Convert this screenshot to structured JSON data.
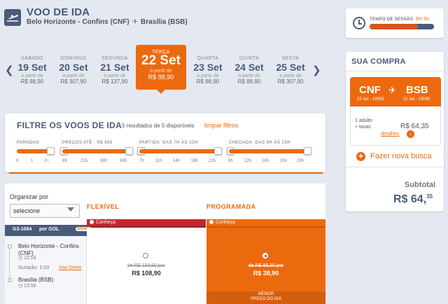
{
  "header": {
    "title": "VOO DE IDA",
    "origin": "Belo Horizonte - Confins  (CNF)",
    "destination": "Brasília  (BSB)"
  },
  "dates": [
    {
      "weekday": "SÁBADO",
      "date": "19 Set",
      "prefix": "a partir de",
      "price": "R$ 88,90"
    },
    {
      "weekday": "DOMINGO",
      "date": "20 Set",
      "prefix": "a partir de",
      "price": "R$ 307,90"
    },
    {
      "weekday": "SEGUNDA",
      "date": "21 Set",
      "prefix": "a partir de",
      "price": "R$ 137,90"
    },
    {
      "weekday": "TERÇA",
      "date": "22 Set",
      "prefix": "a partir de",
      "price": "R$ 88,90",
      "selected": true
    },
    {
      "weekday": "QUARTA",
      "date": "23 Set",
      "prefix": "a partir de",
      "price": "R$ 88,90"
    },
    {
      "weekday": "QUINTA",
      "date": "24 Set",
      "prefix": "a partir de",
      "price": "R$ 88,90"
    },
    {
      "weekday": "SEXTA",
      "date": "25 Set",
      "prefix": "a partir de",
      "price": "R$ 307,90"
    }
  ],
  "filter": {
    "title": "FILTRE OS VOOS DE IDA",
    "results": "5 resultados de 5 disponíveis",
    "clear": "limpar filtros",
    "sliders": [
      {
        "label": "PARADAS:",
        "ticks": [
          "0",
          "1",
          "2+"
        ],
        "min": 0,
        "max": 1
      },
      {
        "label": "PREÇOS ATÉ : R$ 565",
        "ticks": [
          "89",
          "215",
          "390",
          "565"
        ],
        "min": 0,
        "max": 1
      },
      {
        "label": "PARTIDA: DAS 7H ÀS 22H",
        "ticks": [
          "7h",
          "11h",
          "14h",
          "18h",
          "22h"
        ],
        "min": 0,
        "max": 1
      },
      {
        "label": "CHEGADA: DAS 9H ÀS 23H",
        "ticks": [
          "9h",
          "12h",
          "16h",
          "20h",
          "23h"
        ],
        "min": 0,
        "max": 1
      }
    ]
  },
  "results": {
    "organize_label": "Organizar por",
    "organize_value": "selecione",
    "col_flex": "FLEXÍVEL",
    "col_prog": "PROGRAMADA",
    "band_flex": "Conheça",
    "band_prog": "Conheça",
    "flight": {
      "number": "G3-1084",
      "airline_prefix": "por",
      "airline": "GOL",
      "logo": "Smiles",
      "origin": "Belo Horizonte - Confins (CNF)",
      "origin_time": "12:53",
      "duration": "Duração: 1:03",
      "type": "Voo Direto",
      "destination": "Brasília  (BSB)",
      "dest_time": "13:56"
    },
    "flex_old": "de R$ 158,90 por",
    "flex_price": "R$ 108,90",
    "prog_old": "de R$ 88,90 por",
    "prog_price": "R$ 38,90",
    "prog_badge_1": "MENOR",
    "prog_badge_2": "PREÇO DO DIA"
  },
  "session": {
    "label": "TEMPO DE SESSÃO",
    "time": "6m 9s",
    "progress": 0.75
  },
  "purchase": {
    "title": "SUA COMPRA",
    "from": "CNF",
    "to": "BSB",
    "from_dt": "22 set - 12h53",
    "to_dt": "22 set - 13h56",
    "pax_line1": "1 adulto",
    "pax_line2": "+ taxas",
    "pax_price": "R$ 64,35",
    "details": "detalhes",
    "new_search": "Fazer nova busca",
    "subtotal_label": "Subtotal",
    "subtotal_main": "R$ 64,",
    "subtotal_cents": "35"
  },
  "colors": {
    "accent": "#ec6a0e",
    "navy": "#4a5b79",
    "flex_red": "#c0282e"
  },
  "icons": {
    "header": "plane-takeoff-icon",
    "clock": "clock-icon",
    "plane": "plane-icon"
  }
}
